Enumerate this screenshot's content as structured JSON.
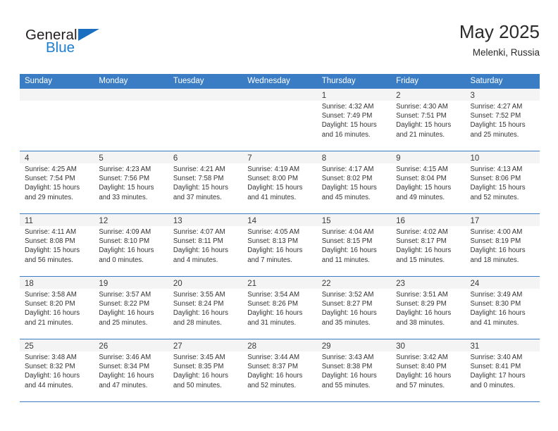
{
  "brand": {
    "name_top": "General",
    "name_bottom": "Blue",
    "triangle_color": "#1b6fc0",
    "blue_text_color": "#1b7fd4"
  },
  "header": {
    "title": "May 2025",
    "subtitle": "Melenki, Russia"
  },
  "theme": {
    "header_bg": "#3B7DC4",
    "header_text": "#FFFFFF",
    "shaded_cell_bg": "#F4F4F4",
    "grid_line": "#3B7DC4",
    "body_text": "#333333"
  },
  "weekdays": [
    "Sunday",
    "Monday",
    "Tuesday",
    "Wednesday",
    "Thursday",
    "Friday",
    "Saturday"
  ],
  "weeks": [
    [
      {
        "day": "",
        "sunrise": "",
        "sunset": "",
        "daylight1": "",
        "daylight2": ""
      },
      {
        "day": "",
        "sunrise": "",
        "sunset": "",
        "daylight1": "",
        "daylight2": ""
      },
      {
        "day": "",
        "sunrise": "",
        "sunset": "",
        "daylight1": "",
        "daylight2": ""
      },
      {
        "day": "",
        "sunrise": "",
        "sunset": "",
        "daylight1": "",
        "daylight2": ""
      },
      {
        "day": "1",
        "sunrise": "Sunrise: 4:32 AM",
        "sunset": "Sunset: 7:49 PM",
        "daylight1": "Daylight: 15 hours",
        "daylight2": "and 16 minutes."
      },
      {
        "day": "2",
        "sunrise": "Sunrise: 4:30 AM",
        "sunset": "Sunset: 7:51 PM",
        "daylight1": "Daylight: 15 hours",
        "daylight2": "and 21 minutes."
      },
      {
        "day": "3",
        "sunrise": "Sunrise: 4:27 AM",
        "sunset": "Sunset: 7:52 PM",
        "daylight1": "Daylight: 15 hours",
        "daylight2": "and 25 minutes."
      }
    ],
    [
      {
        "day": "4",
        "sunrise": "Sunrise: 4:25 AM",
        "sunset": "Sunset: 7:54 PM",
        "daylight1": "Daylight: 15 hours",
        "daylight2": "and 29 minutes."
      },
      {
        "day": "5",
        "sunrise": "Sunrise: 4:23 AM",
        "sunset": "Sunset: 7:56 PM",
        "daylight1": "Daylight: 15 hours",
        "daylight2": "and 33 minutes."
      },
      {
        "day": "6",
        "sunrise": "Sunrise: 4:21 AM",
        "sunset": "Sunset: 7:58 PM",
        "daylight1": "Daylight: 15 hours",
        "daylight2": "and 37 minutes."
      },
      {
        "day": "7",
        "sunrise": "Sunrise: 4:19 AM",
        "sunset": "Sunset: 8:00 PM",
        "daylight1": "Daylight: 15 hours",
        "daylight2": "and 41 minutes."
      },
      {
        "day": "8",
        "sunrise": "Sunrise: 4:17 AM",
        "sunset": "Sunset: 8:02 PM",
        "daylight1": "Daylight: 15 hours",
        "daylight2": "and 45 minutes."
      },
      {
        "day": "9",
        "sunrise": "Sunrise: 4:15 AM",
        "sunset": "Sunset: 8:04 PM",
        "daylight1": "Daylight: 15 hours",
        "daylight2": "and 49 minutes."
      },
      {
        "day": "10",
        "sunrise": "Sunrise: 4:13 AM",
        "sunset": "Sunset: 8:06 PM",
        "daylight1": "Daylight: 15 hours",
        "daylight2": "and 52 minutes."
      }
    ],
    [
      {
        "day": "11",
        "sunrise": "Sunrise: 4:11 AM",
        "sunset": "Sunset: 8:08 PM",
        "daylight1": "Daylight: 15 hours",
        "daylight2": "and 56 minutes."
      },
      {
        "day": "12",
        "sunrise": "Sunrise: 4:09 AM",
        "sunset": "Sunset: 8:10 PM",
        "daylight1": "Daylight: 16 hours",
        "daylight2": "and 0 minutes."
      },
      {
        "day": "13",
        "sunrise": "Sunrise: 4:07 AM",
        "sunset": "Sunset: 8:11 PM",
        "daylight1": "Daylight: 16 hours",
        "daylight2": "and 4 minutes."
      },
      {
        "day": "14",
        "sunrise": "Sunrise: 4:05 AM",
        "sunset": "Sunset: 8:13 PM",
        "daylight1": "Daylight: 16 hours",
        "daylight2": "and 7 minutes."
      },
      {
        "day": "15",
        "sunrise": "Sunrise: 4:04 AM",
        "sunset": "Sunset: 8:15 PM",
        "daylight1": "Daylight: 16 hours",
        "daylight2": "and 11 minutes."
      },
      {
        "day": "16",
        "sunrise": "Sunrise: 4:02 AM",
        "sunset": "Sunset: 8:17 PM",
        "daylight1": "Daylight: 16 hours",
        "daylight2": "and 15 minutes."
      },
      {
        "day": "17",
        "sunrise": "Sunrise: 4:00 AM",
        "sunset": "Sunset: 8:19 PM",
        "daylight1": "Daylight: 16 hours",
        "daylight2": "and 18 minutes."
      }
    ],
    [
      {
        "day": "18",
        "sunrise": "Sunrise: 3:58 AM",
        "sunset": "Sunset: 8:20 PM",
        "daylight1": "Daylight: 16 hours",
        "daylight2": "and 21 minutes."
      },
      {
        "day": "19",
        "sunrise": "Sunrise: 3:57 AM",
        "sunset": "Sunset: 8:22 PM",
        "daylight1": "Daylight: 16 hours",
        "daylight2": "and 25 minutes."
      },
      {
        "day": "20",
        "sunrise": "Sunrise: 3:55 AM",
        "sunset": "Sunset: 8:24 PM",
        "daylight1": "Daylight: 16 hours",
        "daylight2": "and 28 minutes."
      },
      {
        "day": "21",
        "sunrise": "Sunrise: 3:54 AM",
        "sunset": "Sunset: 8:26 PM",
        "daylight1": "Daylight: 16 hours",
        "daylight2": "and 31 minutes."
      },
      {
        "day": "22",
        "sunrise": "Sunrise: 3:52 AM",
        "sunset": "Sunset: 8:27 PM",
        "daylight1": "Daylight: 16 hours",
        "daylight2": "and 35 minutes."
      },
      {
        "day": "23",
        "sunrise": "Sunrise: 3:51 AM",
        "sunset": "Sunset: 8:29 PM",
        "daylight1": "Daylight: 16 hours",
        "daylight2": "and 38 minutes."
      },
      {
        "day": "24",
        "sunrise": "Sunrise: 3:49 AM",
        "sunset": "Sunset: 8:30 PM",
        "daylight1": "Daylight: 16 hours",
        "daylight2": "and 41 minutes."
      }
    ],
    [
      {
        "day": "25",
        "sunrise": "Sunrise: 3:48 AM",
        "sunset": "Sunset: 8:32 PM",
        "daylight1": "Daylight: 16 hours",
        "daylight2": "and 44 minutes."
      },
      {
        "day": "26",
        "sunrise": "Sunrise: 3:46 AM",
        "sunset": "Sunset: 8:34 PM",
        "daylight1": "Daylight: 16 hours",
        "daylight2": "and 47 minutes."
      },
      {
        "day": "27",
        "sunrise": "Sunrise: 3:45 AM",
        "sunset": "Sunset: 8:35 PM",
        "daylight1": "Daylight: 16 hours",
        "daylight2": "and 50 minutes."
      },
      {
        "day": "28",
        "sunrise": "Sunrise: 3:44 AM",
        "sunset": "Sunset: 8:37 PM",
        "daylight1": "Daylight: 16 hours",
        "daylight2": "and 52 minutes."
      },
      {
        "day": "29",
        "sunrise": "Sunrise: 3:43 AM",
        "sunset": "Sunset: 8:38 PM",
        "daylight1": "Daylight: 16 hours",
        "daylight2": "and 55 minutes."
      },
      {
        "day": "30",
        "sunrise": "Sunrise: 3:42 AM",
        "sunset": "Sunset: 8:40 PM",
        "daylight1": "Daylight: 16 hours",
        "daylight2": "and 57 minutes."
      },
      {
        "day": "31",
        "sunrise": "Sunrise: 3:40 AM",
        "sunset": "Sunset: 8:41 PM",
        "daylight1": "Daylight: 17 hours",
        "daylight2": "and 0 minutes."
      }
    ]
  ]
}
